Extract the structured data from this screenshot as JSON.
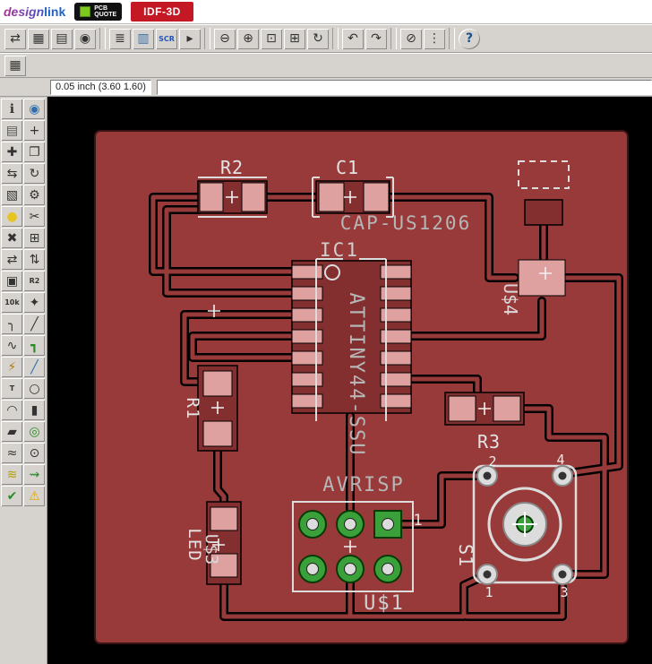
{
  "header": {
    "logo_design": "design",
    "logo_link": "link",
    "pcbquote_line1": "PCB",
    "pcbquote_line2": "QUOTE",
    "idf3d_label": "IDF-3D"
  },
  "coordbar": {
    "coordinates": "0.05 inch (3.60 1.60)",
    "command_value": ""
  },
  "colors": {
    "board": "#993a3a",
    "footprint": "#842f2f",
    "pad": "#dfa0a0",
    "green": "#3aa03a",
    "hole": "#dcdcdc",
    "silk": "#dcdcdc",
    "bg": "#000000"
  },
  "toolbar": {
    "icons": [
      {
        "name": "board-schematic-switch-icon",
        "glyph": "⇄"
      },
      {
        "name": "save-icon",
        "glyph": "▦"
      },
      {
        "name": "print-icon",
        "glyph": "▤"
      },
      {
        "name": "cam-export-icon",
        "glyph": "◉"
      },
      {
        "sep": true
      },
      {
        "name": "ulp-icon",
        "glyph": "≣"
      },
      {
        "name": "layer-settings-icon",
        "glyph": "▥",
        "color": "#3a6ea5"
      },
      {
        "name": "script-icon",
        "glyph": "SCR",
        "cls": "txt",
        "color": "#2255bb"
      },
      {
        "name": "run-icon",
        "glyph": "▸"
      },
      {
        "sep": true
      },
      {
        "name": "zoom-out-icon",
        "glyph": "⊖"
      },
      {
        "name": "zoom-in-icon",
        "glyph": "⊕"
      },
      {
        "name": "zoom-fit-icon",
        "glyph": "⊡"
      },
      {
        "name": "zoom-select-icon",
        "glyph": "⊞"
      },
      {
        "name": "zoom-redraw-icon",
        "glyph": "↻"
      },
      {
        "sep": true
      },
      {
        "name": "undo-icon",
        "glyph": "↶"
      },
      {
        "name": "redo-icon",
        "glyph": "↷"
      },
      {
        "sep": true
      },
      {
        "name": "stop-icon",
        "glyph": "⊘"
      },
      {
        "name": "options-icon",
        "glyph": "⋮"
      },
      {
        "sep": true
      },
      {
        "name": "help-icon",
        "glyph": "?",
        "cls": "round"
      }
    ]
  },
  "toolbar2": {
    "icons": [
      {
        "name": "grid-icon",
        "glyph": "▦"
      }
    ]
  },
  "palette": {
    "icons": [
      {
        "name": "info-tool-icon",
        "glyph": "ℹ"
      },
      {
        "name": "show-eye-icon",
        "glyph": "◉",
        "color": "#2f6fae"
      },
      {
        "name": "display-layers-icon",
        "glyph": "▤",
        "color": "#555555"
      },
      {
        "name": "mark-icon",
        "glyph": "+"
      },
      {
        "name": "move-icon",
        "glyph": "✚"
      },
      {
        "name": "copy-icon",
        "glyph": "❐"
      },
      {
        "name": "mirror-icon",
        "glyph": "⇆"
      },
      {
        "name": "rotate-icon",
        "glyph": "↻"
      },
      {
        "name": "group-icon",
        "glyph": "▧"
      },
      {
        "name": "change-wrench-icon",
        "glyph": "⚙"
      },
      {
        "name": "paint-icon",
        "glyph": "●",
        "color": "#e8c422"
      },
      {
        "name": "cut-icon",
        "glyph": "✂"
      },
      {
        "name": "delete-icon",
        "glyph": "✖"
      },
      {
        "name": "add-icon",
        "glyph": "⊞"
      },
      {
        "name": "pinswap-icon",
        "glyph": "⇄"
      },
      {
        "name": "replace-icon",
        "glyph": "⇅"
      },
      {
        "name": "lock-icon",
        "glyph": "▣"
      },
      {
        "name": "name-icon",
        "glyph": "R2",
        "cls": "txt"
      },
      {
        "name": "value-icon",
        "glyph": "10k",
        "cls": "txt"
      },
      {
        "name": "smash-icon",
        "glyph": "✦"
      },
      {
        "name": "miter-icon",
        "glyph": "╮"
      },
      {
        "name": "split-icon",
        "glyph": "╱"
      },
      {
        "name": "meander-icon",
        "glyph": "∿"
      },
      {
        "name": "route-icon",
        "glyph": "┓",
        "color": "#2c8c2c"
      },
      {
        "name": "ripup-icon",
        "glyph": "⚡",
        "color": "#b07a10"
      },
      {
        "name": "wire-icon",
        "glyph": "╱",
        "color": "#2f6fae"
      },
      {
        "name": "text-icon",
        "glyph": "T",
        "cls": "txt"
      },
      {
        "name": "circle-icon",
        "glyph": "○"
      },
      {
        "name": "arc-icon",
        "glyph": "◠"
      },
      {
        "name": "rect-icon",
        "glyph": "▮"
      },
      {
        "name": "polygon-icon",
        "glyph": "▰"
      },
      {
        "name": "via-icon",
        "glyph": "◎",
        "color": "#2c8c2c"
      },
      {
        "name": "signal-icon",
        "glyph": "≈"
      },
      {
        "name": "hole-icon",
        "glyph": "⊙"
      },
      {
        "name": "ratsnest-icon",
        "glyph": "≋",
        "color": "#b8a000"
      },
      {
        "name": "auto-route-icon",
        "glyph": "⇝",
        "color": "#2c8c2c"
      },
      {
        "name": "drc-check-icon",
        "glyph": "✔",
        "color": "#2c8c2c"
      },
      {
        "name": "errors-icon",
        "glyph": "⚠",
        "color": "#e0a800"
      }
    ]
  },
  "board": {
    "labels": {
      "r2": "R2",
      "c1": "C1",
      "cap": "CAP-US1206",
      "ic1": "IC1",
      "attiny": "ATTINY44-SSU",
      "u4": "U$4",
      "r1": "R1",
      "r3": "R3",
      "avrisp": "AVRISP",
      "pin1": "1",
      "u1": "U$1",
      "led": "LED",
      "u3": "U$3",
      "s1": "S1",
      "sw2": "2",
      "sw4": "4",
      "sw1": "1",
      "sw3": "3"
    }
  }
}
